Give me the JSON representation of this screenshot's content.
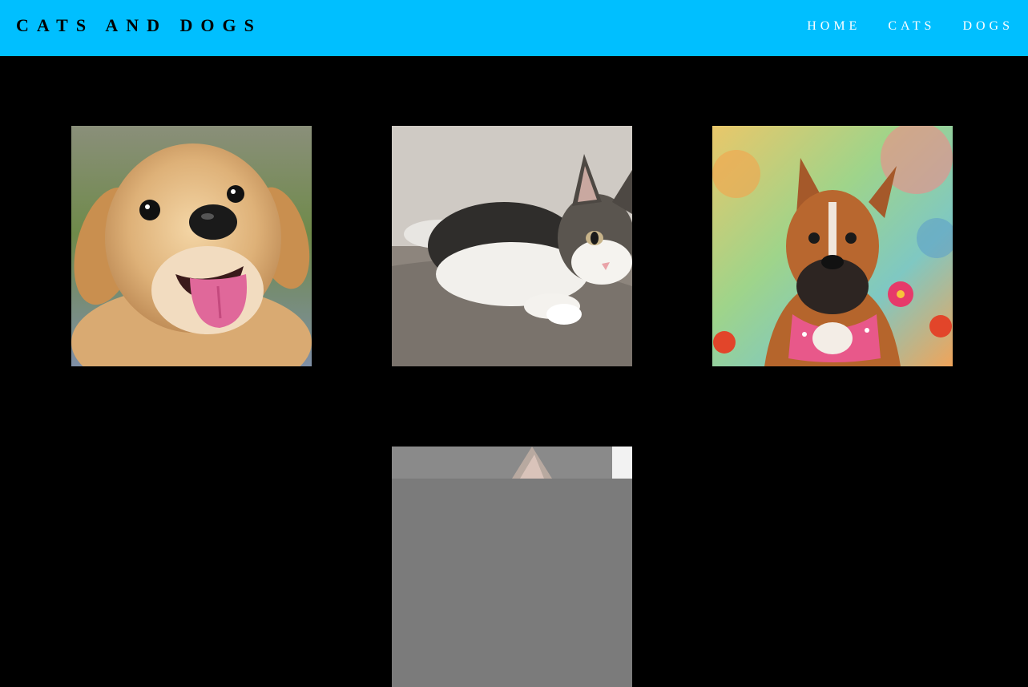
{
  "header": {
    "brand": "CATS AND DOGS",
    "nav": [
      {
        "label": "HOME"
      },
      {
        "label": "CATS"
      },
      {
        "label": "DOGS"
      }
    ]
  },
  "gallery": [
    {
      "subject": "golden-retriever-puppy"
    },
    {
      "subject": "tabby-white-kitten"
    },
    {
      "subject": "boxer-dog-with-pink-bandana"
    },
    {
      "subject": "gray-cat"
    }
  ],
  "colors": {
    "navbar": "#00bfff",
    "brand_text": "#000000",
    "nav_text": "#ffffff",
    "background": "#000000"
  }
}
